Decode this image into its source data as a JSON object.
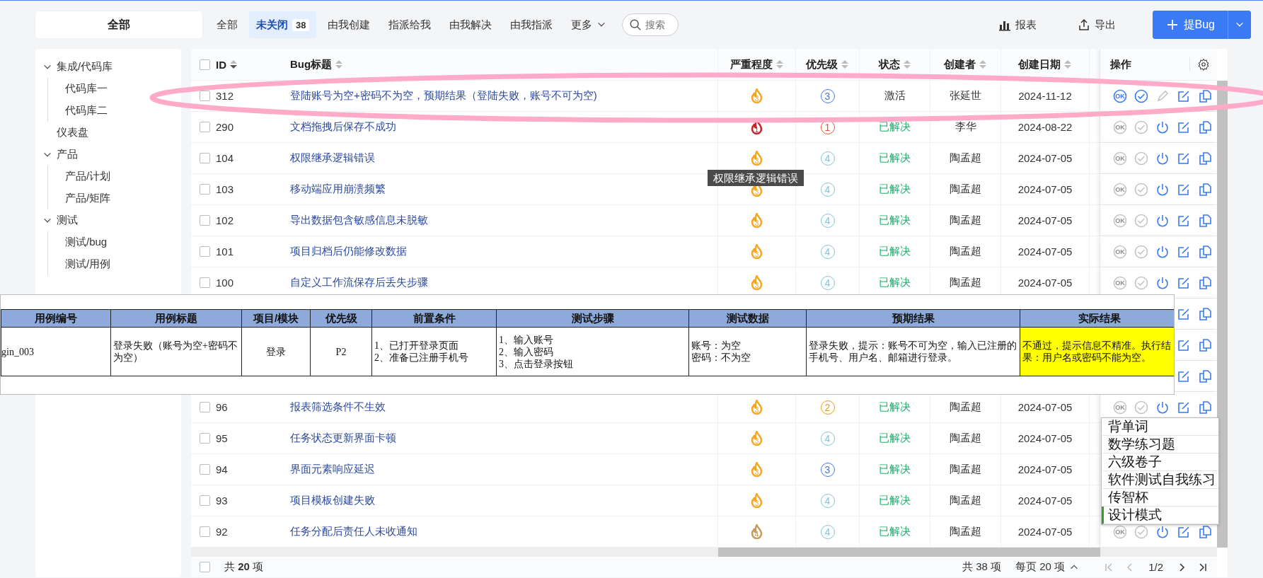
{
  "filter_bar": {
    "sidebar_header": "全部",
    "tabs": [
      {
        "label": "全部",
        "selected": false
      },
      {
        "label": "未关闭",
        "count": "38",
        "selected": true
      },
      {
        "label": "由我创建",
        "selected": false
      },
      {
        "label": "指派给我",
        "selected": false
      },
      {
        "label": "由我解决",
        "selected": false
      },
      {
        "label": "由我指派",
        "selected": false
      },
      {
        "label": "更多",
        "kind": "menu",
        "selected": false
      }
    ],
    "search": {
      "placeholder": "搜索"
    },
    "tools": [
      {
        "label": "报表",
        "kind": "report"
      },
      {
        "label": "导出",
        "kind": "export"
      }
    ],
    "primary_button": {
      "label": "提Bug"
    }
  },
  "sidebar": {
    "items": [
      {
        "label": "集成/代码库",
        "expanded": true,
        "children": [
          {
            "label": "代码库一"
          },
          {
            "label": "代码库二"
          }
        ]
      },
      {
        "label": "仪表盘"
      },
      {
        "label": "产品",
        "expanded": true,
        "children": [
          {
            "label": "产品/计划"
          },
          {
            "label": "产品/矩阵"
          }
        ]
      },
      {
        "label": "测试",
        "expanded": true,
        "children": [
          {
            "label": "测试/bug"
          },
          {
            "label": "测试/用例"
          }
        ]
      }
    ]
  },
  "table": {
    "header_checked": false,
    "columns": [
      {
        "label": "ID",
        "sorted": true
      },
      {
        "label": "Bug标题",
        "sorted": false
      },
      {
        "label": "严重程度",
        "sorted": false
      },
      {
        "label": "优先级",
        "sorted": false
      },
      {
        "label": "状态",
        "sorted": false
      },
      {
        "label": "创建者",
        "sorted": false
      },
      {
        "label": "创建日期",
        "sorted": false
      }
    ],
    "actions_header": "操作",
    "rows": [
      {
        "checked": false,
        "id": "312",
        "title": "登陆账号为空+密码不为空，预期结果（登陆失败，账号不可为空)",
        "severity": {
          "value": "3",
          "color": "#f5a623"
        },
        "priority": {
          "value": "3",
          "color": "#3a7af5"
        },
        "status": {
          "text": "激活",
          "kind": "active"
        },
        "creator": "张延世",
        "date": "2024-11-12",
        "actions": [
          {
            "kind": "ok",
            "label": "OK",
            "disabled": false
          },
          {
            "kind": "confirm",
            "disabled": false
          },
          {
            "kind": "assign",
            "disabled": true
          },
          {
            "kind": "edit",
            "disabled": false
          },
          {
            "kind": "copy",
            "disabled": false
          }
        ]
      },
      {
        "checked": false,
        "id": "290",
        "title": "文档拖拽后保存不成功",
        "severity": {
          "value": "1",
          "color": "#c0282d"
        },
        "priority": {
          "value": "1",
          "color": "#f0522a"
        },
        "status": {
          "text": "已解决",
          "kind": "resolved"
        },
        "creator": "李华",
        "date": "2024-08-22",
        "actions": [
          {
            "kind": "ok",
            "label": "OK",
            "disabled": true
          },
          {
            "kind": "confirm",
            "disabled": true
          },
          {
            "kind": "close",
            "disabled": false
          },
          {
            "kind": "edit",
            "disabled": false
          },
          {
            "kind": "copy",
            "disabled": false
          }
        ]
      },
      {
        "checked": false,
        "id": "104",
        "title": "权限继承逻辑错误",
        "severity": {
          "value": "3",
          "color": "#f5a623"
        },
        "priority": {
          "value": "4",
          "color": "#7fc6d4"
        },
        "status": {
          "text": "已解决",
          "kind": "resolved"
        },
        "creator": "陶孟超",
        "date": "2024-07-05",
        "actions": [
          {
            "kind": "ok",
            "label": "OK",
            "disabled": true
          },
          {
            "kind": "confirm",
            "disabled": true
          },
          {
            "kind": "close",
            "disabled": false
          },
          {
            "kind": "edit",
            "disabled": false
          },
          {
            "kind": "copy",
            "disabled": false
          }
        ]
      },
      {
        "checked": false,
        "id": "103",
        "title": "移动端应用崩溃频繁",
        "severity": {
          "value": "3",
          "color": "#f5a623"
        },
        "priority": {
          "value": "4",
          "color": "#7fc6d4"
        },
        "status": {
          "text": "已解决",
          "kind": "resolved"
        },
        "creator": "陶孟超",
        "date": "2024-07-05",
        "actions": [
          {
            "kind": "ok",
            "label": "OK",
            "disabled": true
          },
          {
            "kind": "confirm",
            "disabled": true
          },
          {
            "kind": "close",
            "disabled": false
          },
          {
            "kind": "edit",
            "disabled": false
          },
          {
            "kind": "copy",
            "disabled": false
          }
        ]
      },
      {
        "checked": false,
        "id": "102",
        "title": "导出数据包含敏感信息未脱敏",
        "severity": {
          "value": "3",
          "color": "#f5a623"
        },
        "priority": {
          "value": "4",
          "color": "#7fc6d4"
        },
        "status": {
          "text": "已解决",
          "kind": "resolved"
        },
        "creator": "陶孟超",
        "date": "2024-07-05",
        "actions": [
          {
            "kind": "ok",
            "label": "OK",
            "disabled": true
          },
          {
            "kind": "confirm",
            "disabled": true
          },
          {
            "kind": "close",
            "disabled": false
          },
          {
            "kind": "edit",
            "disabled": false
          },
          {
            "kind": "copy",
            "disabled": false
          }
        ]
      },
      {
        "checked": false,
        "id": "101",
        "title": "项目归档后仍能修改数据",
        "severity": {
          "value": "3",
          "color": "#f5a623"
        },
        "priority": {
          "value": "4",
          "color": "#7fc6d4"
        },
        "status": {
          "text": "已解决",
          "kind": "resolved"
        },
        "creator": "陶孟超",
        "date": "2024-07-05",
        "actions": [
          {
            "kind": "ok",
            "label": "OK",
            "disabled": true
          },
          {
            "kind": "confirm",
            "disabled": true
          },
          {
            "kind": "close",
            "disabled": false
          },
          {
            "kind": "edit",
            "disabled": false
          },
          {
            "kind": "copy",
            "disabled": false
          }
        ]
      },
      {
        "checked": false,
        "id": "100",
        "title": "自定义工作流保存后丢失步骤",
        "severity": {
          "value": "3",
          "color": "#f5a623"
        },
        "priority": {
          "value": "4",
          "color": "#7fc6d4"
        },
        "status": {
          "text": "已解决",
          "kind": "resolved"
        },
        "creator": "陶孟超",
        "date": "2024-07-05",
        "actions": [
          {
            "kind": "ok",
            "label": "OK",
            "disabled": true
          },
          {
            "kind": "confirm",
            "disabled": true
          },
          {
            "kind": "close",
            "disabled": false
          },
          {
            "kind": "edit",
            "disabled": false
          },
          {
            "kind": "copy",
            "disabled": false
          }
        ]
      },
      {
        "actions": [
          {
            "kind": "edit",
            "disabled": false
          },
          {
            "kind": "copy",
            "disabled": false
          }
        ]
      },
      {
        "actions": [
          {
            "kind": "edit",
            "disabled": false
          },
          {
            "kind": "copy",
            "disabled": false
          }
        ]
      },
      {
        "actions": [
          {
            "kind": "edit",
            "disabled": false
          },
          {
            "kind": "copy",
            "disabled": false
          }
        ]
      },
      {
        "checked": false,
        "id": "96",
        "title": "报表筛选条件不生效",
        "severity": {
          "value": "3",
          "color": "#f5a623"
        },
        "priority": {
          "value": "2",
          "color": "#f0952a"
        },
        "status": {
          "text": "已解决",
          "kind": "resolved"
        },
        "creator": "陶孟超",
        "date": "2024-07-05",
        "actions": [
          {
            "kind": "ok",
            "label": "OK",
            "disabled": true
          },
          {
            "kind": "confirm",
            "disabled": true
          },
          {
            "kind": "close",
            "disabled": false
          },
          {
            "kind": "edit",
            "disabled": false
          },
          {
            "kind": "copy",
            "disabled": false
          }
        ]
      },
      {
        "checked": false,
        "id": "95",
        "title": "任务状态更新界面卡顿",
        "severity": {
          "value": "3",
          "color": "#f5a623"
        },
        "priority": {
          "value": "4",
          "color": "#7fc6d4"
        },
        "status": {
          "text": "已解决",
          "kind": "resolved"
        },
        "creator": "陶孟超",
        "date": "2024-07-05",
        "actions": []
      },
      {
        "checked": false,
        "id": "94",
        "title": "界面元素响应延迟",
        "severity": {
          "value": "3",
          "color": "#f5a623"
        },
        "priority": {
          "value": "3",
          "color": "#3a7af5"
        },
        "status": {
          "text": "已解决",
          "kind": "resolved"
        },
        "creator": "陶孟超",
        "date": "2024-07-05",
        "actions": []
      },
      {
        "checked": false,
        "id": "93",
        "title": "项目模板创建失败",
        "severity": {
          "value": "3",
          "color": "#f5a623"
        },
        "priority": {
          "value": "4",
          "color": "#7fc6d4"
        },
        "status": {
          "text": "已解决",
          "kind": "resolved"
        },
        "creator": "陶孟超",
        "date": "2024-07-05",
        "actions": []
      },
      {
        "checked": false,
        "id": "92",
        "title": "任务分配后责任人未收通知",
        "severity": {
          "value": "4",
          "color": "#c49a5e"
        },
        "priority": {
          "value": "4",
          "color": "#7fc6d4"
        },
        "status": {
          "text": "已解决",
          "kind": "resolved"
        },
        "creator": "陶孟超",
        "date": "2024-07-05",
        "actions": [
          {
            "kind": "ok",
            "label": "OK",
            "disabled": true
          },
          {
            "kind": "confirm",
            "disabled": true
          },
          {
            "kind": "close",
            "disabled": false
          },
          {
            "kind": "edit",
            "disabled": false
          },
          {
            "kind": "copy",
            "disabled": false
          }
        ]
      }
    ],
    "footer": {
      "checked": false,
      "selection_total": "共 **20** 项",
      "total": "共 38 项",
      "page_size": "每页 20 项",
      "page": "1/2",
      "pager": [
        {
          "kind": "first",
          "disabled": true
        },
        {
          "kind": "prev",
          "disabled": true
        },
        {
          "kind": "next",
          "disabled": false
        },
        {
          "kind": "last",
          "disabled": false
        }
      ]
    }
  },
  "test_case_sheet": {
    "columns": [
      "用例编号",
      "用例标题",
      "项目/模块",
      "优先级",
      "前置条件",
      "测试步骤",
      "测试数据",
      "预期结果",
      "实际结果"
    ],
    "cells": [
      {
        "text": "gin_003"
      },
      {
        "text": "登录失败（账号为空+密码不为空）"
      },
      {
        "text": "登录"
      },
      {
        "text": "P2"
      },
      {
        "lines": [
          "1、已打开登录页面",
          "2、准备已注册手机号"
        ]
      },
      {
        "lines": [
          "1、输入账号",
          "2、输入密码",
          "3、点击登录按钮"
        ]
      },
      {
        "lines": [
          "账号：为空",
          "密码：不为空"
        ]
      },
      {
        "text": "登录失败，提示：账号不可为空，输入已注册的手机号、用户名、邮箱进行登录。"
      },
      {
        "text": "不通过，提示信息不精准。执行结果：用户名或密码不能为空。",
        "color": "#ffff00"
      }
    ]
  },
  "tooltip": {
    "text": "权限继承逻辑错误"
  },
  "dropdown": {
    "items": [
      {
        "label": "背单词",
        "selected": false
      },
      {
        "label": "数学练习题",
        "selected": false
      },
      {
        "label": "六级卷子",
        "selected": false
      },
      {
        "label": "软件测试自我练习",
        "selected": false
      },
      {
        "label": "传智杯",
        "selected": false
      },
      {
        "label": "设计模式",
        "selected": true
      }
    ]
  }
}
